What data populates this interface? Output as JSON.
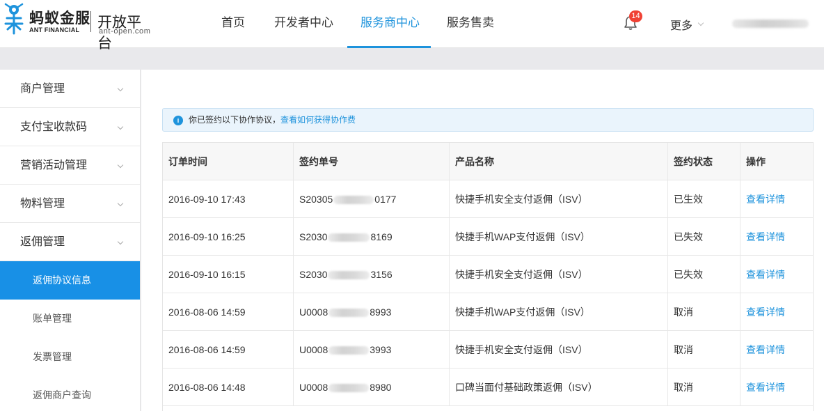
{
  "brand": {
    "logo_cn": "蚂蚁金服",
    "logo_en": "ANT FINANCIAL",
    "platform_name": "开放平台",
    "platform_url": "ant-open.com"
  },
  "nav": {
    "items": [
      {
        "label": "首页"
      },
      {
        "label": "开发者中心"
      },
      {
        "label": "服务商中心",
        "active": true
      },
      {
        "label": "服务售卖"
      }
    ],
    "notification_count": "14",
    "more_label": "更多"
  },
  "sidebar": {
    "groups": [
      {
        "label": "商户管理"
      },
      {
        "label": "支付宝收款码"
      },
      {
        "label": "营销活动管理"
      },
      {
        "label": "物料管理"
      },
      {
        "label": "返佣管理"
      }
    ],
    "sub_items": [
      {
        "label": "返佣协议信息",
        "active": true
      },
      {
        "label": "账单管理"
      },
      {
        "label": "发票管理"
      },
      {
        "label": "返佣商户查询"
      }
    ]
  },
  "notice": {
    "icon": "info-icon",
    "text": "你已签约以下协作协议，",
    "link": "查看如何获得协作费"
  },
  "table": {
    "headers": [
      "订单时间",
      "签约单号",
      "产品名称",
      "签约状态",
      "操作"
    ],
    "rows": [
      {
        "time": "2016-09-10 17:43",
        "no_prefix": "S20305",
        "no_suffix": "0177",
        "product": "快捷手机安全支付返佣（ISV）",
        "status": "已生效",
        "action": "查看详情"
      },
      {
        "time": "2016-09-10 16:25",
        "no_prefix": "S2030",
        "no_suffix": "8169",
        "product": "快捷手机WAP支付返佣（ISV）",
        "status": "已失效",
        "action": "查看详情"
      },
      {
        "time": "2016-09-10 16:15",
        "no_prefix": "S2030",
        "no_suffix": "3156",
        "product": "快捷手机安全支付返佣（ISV）",
        "status": "已失效",
        "action": "查看详情"
      },
      {
        "time": "2016-08-06 14:59",
        "no_prefix": "U0008",
        "no_suffix": "8993",
        "product": "快捷手机WAP支付返佣（ISV）",
        "status": "取消",
        "action": "查看详情"
      },
      {
        "time": "2016-08-06 14:59",
        "no_prefix": "U0008",
        "no_suffix": "3993",
        "product": "快捷手机安全支付返佣（ISV）",
        "status": "取消",
        "action": "查看详情"
      },
      {
        "time": "2016-08-06 14:48",
        "no_prefix": "U0008",
        "no_suffix": "8980",
        "product": "口碑当面付基础政策返佣（ISV）",
        "status": "取消",
        "action": "查看详情"
      }
    ]
  },
  "colors": {
    "accent": "#1e93dc",
    "active_sidebar": "#1890e6",
    "badge": "#f04134"
  }
}
